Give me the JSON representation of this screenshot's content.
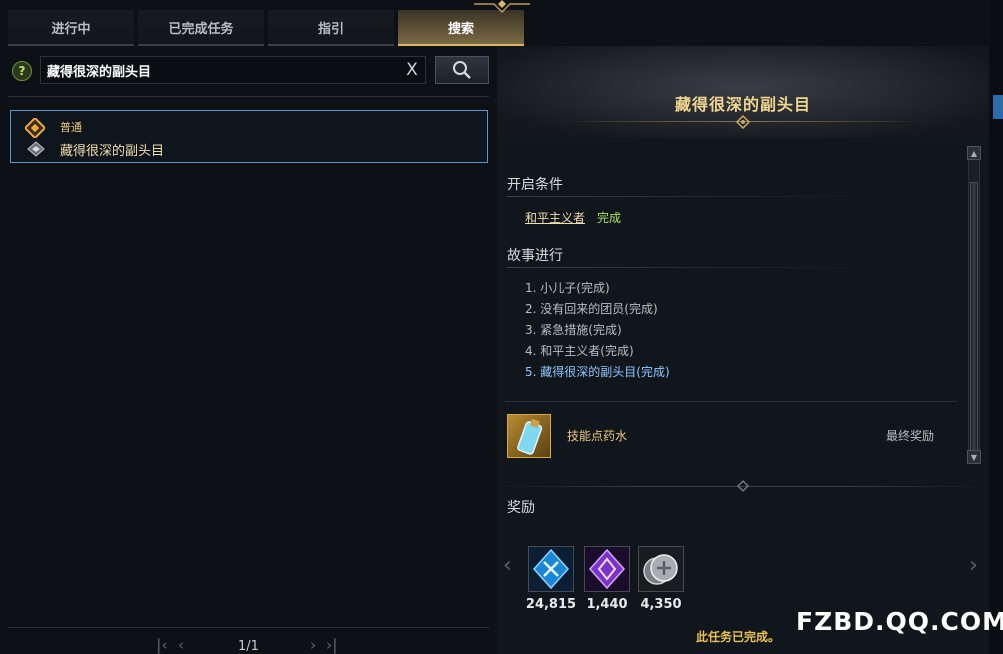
{
  "tabs": [
    {
      "label": "进行中",
      "active": false
    },
    {
      "label": "已完成任务",
      "active": false
    },
    {
      "label": "指引",
      "active": false
    },
    {
      "label": "搜索",
      "active": true
    }
  ],
  "search": {
    "help_icon": "?",
    "value": "藏得很深的副头目",
    "clear_icon": "X",
    "button_icon": "search-icon"
  },
  "results": [
    {
      "type": "普通",
      "name": "藏得很深的副头目",
      "selected": true
    }
  ],
  "pagination": {
    "current": "1/1"
  },
  "detail": {
    "title": "藏得很深的副头目",
    "conditions_header": "开启条件",
    "condition": {
      "name": "和平主义者",
      "status": "完成"
    },
    "story_header": "故事进行",
    "story_steps": [
      "1. 小儿子(完成)",
      "2. 没有回来的团员(完成)",
      "3. 紧急措施(完成)",
      "4. 和平主义者(完成)",
      "5. 藏得很深的副头目(完成)"
    ],
    "final_reward": {
      "item_name": "技能点药水",
      "label": "最终奖励"
    }
  },
  "rewards": {
    "header": "奖励",
    "items": [
      {
        "icon": "blue-crystal-icon",
        "amount": "24,815"
      },
      {
        "icon": "purple-crystal-icon",
        "amount": "1,440"
      },
      {
        "icon": "silver-coin-icon",
        "amount": "4,350"
      }
    ],
    "complete_message": "此任务已完成。"
  },
  "watermark": "FZBD.QQ.COM",
  "colors": {
    "accent_gold": "#f0d690",
    "active_tab": "#7a6a45",
    "selected_border": "#5f92c6",
    "complete_green": "#a6e45a",
    "current_step_blue": "#8fc8ff"
  }
}
